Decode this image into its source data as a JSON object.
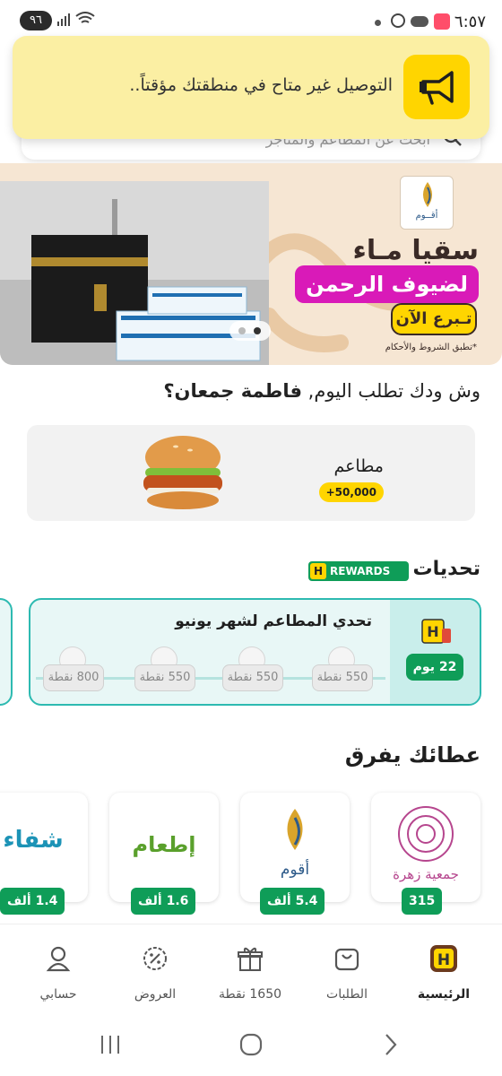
{
  "status_bar": {
    "time": "٦:٥٧",
    "battery": "٩٦",
    "icons": [
      "threads-icon",
      "cloud-icon",
      "app-icon"
    ]
  },
  "search": {
    "placeholder": "ابحث عن المطاعم والمتاجر"
  },
  "toast": {
    "message": "التوصيل غير متاح في منطقتك مؤقتاً..",
    "icon": "megaphone-icon"
  },
  "banner": {
    "title": "سقيا مـاء",
    "subtitle": "لضيوف الرحمن",
    "cta": "تـبرع الآن",
    "terms": "*تطبق الشروط والأحكام",
    "logo_text": "أقــوم",
    "colors": {
      "background": "#f6e6d3",
      "accent": "#d91ab8",
      "cta": "#ffd500"
    }
  },
  "greeting": {
    "prefix": "وش ودك تطلب اليوم, ",
    "name": "فاطمة جمعان؟"
  },
  "restaurants": {
    "title": "مطاعم",
    "badge": "+50,000"
  },
  "challenges": {
    "title": "تحديات",
    "badge": "REWARDS",
    "badge_letter": "H",
    "card": {
      "name": "تحدي المطاعم لشهر يونيو",
      "days": "22 يوم",
      "milestones": [
        "550 نقطة",
        "550 نقطة",
        "550 نقطة",
        "800 نقطة"
      ]
    }
  },
  "donations": {
    "title": "عطائك يفرق",
    "items": [
      {
        "name": "جمعية زهرة",
        "amount": "315"
      },
      {
        "name": "أقوم",
        "amount": "5.4 ألف"
      },
      {
        "name": "إطعام",
        "amount": "1.6 ألف"
      },
      {
        "name": "شفاء",
        "amount": "1.4 ألف"
      }
    ]
  },
  "nav": {
    "items": [
      {
        "label": "الرئيسية",
        "icon": "home-h-icon",
        "active": true
      },
      {
        "label": "الطلبات",
        "icon": "bag-icon",
        "active": false
      },
      {
        "label": "1650 نقطة",
        "icon": "gift-icon",
        "active": false
      },
      {
        "label": "العروض",
        "icon": "discount-icon",
        "active": false
      },
      {
        "label": "حسابي",
        "icon": "profile-icon",
        "active": false
      }
    ]
  },
  "brand_colors": {
    "primary_green": "#0f9d58",
    "yellow": "#ffd500",
    "teal": "#2dbab1"
  }
}
